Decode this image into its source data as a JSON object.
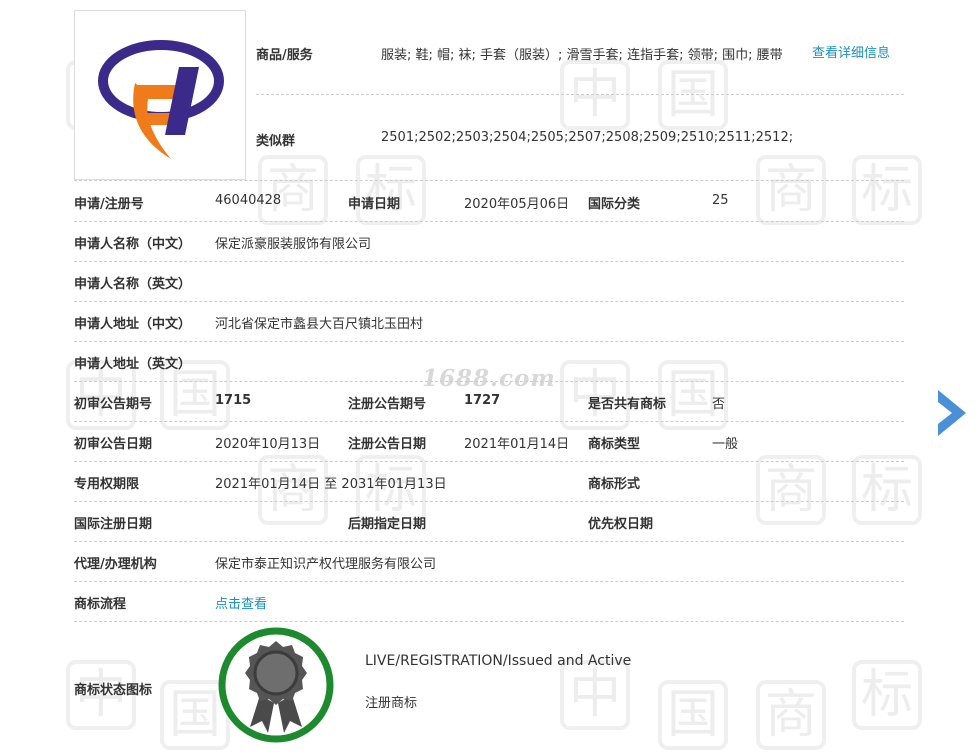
{
  "goods": {
    "label": "商品/服务",
    "value": "服装; 鞋; 帽; 袜; 手套（服装）; 滑雪手套; 连指手套; 领带; 围巾; 腰带",
    "more_link": "查看详细信息"
  },
  "similar_group": {
    "label": "类似群",
    "value": "2501;2502;2503;2504;2505;2507;2508;2509;2510;2511;2512;"
  },
  "rows": {
    "reg_no": {
      "label": "申请/注册号",
      "value": "46040428"
    },
    "app_date": {
      "label": "申请日期",
      "value": "2020年05月06日"
    },
    "intl_class": {
      "label": "国际分类",
      "value": "25"
    },
    "applicant_cn": {
      "label": "申请人名称（中文）",
      "value": "保定派豪服装服饰有限公司"
    },
    "applicant_en": {
      "label": "申请人名称（英文）",
      "value": ""
    },
    "address_cn": {
      "label": "申请人地址（中文）",
      "value": "河北省保定市蠡县大百尺镇北玉田村"
    },
    "address_en": {
      "label": "申请人地址（英文）",
      "value": ""
    },
    "prelim_issue": {
      "label": "初审公告期号",
      "value": "1715"
    },
    "reg_issue": {
      "label": "注册公告期号",
      "value": "1727"
    },
    "shared": {
      "label": "是否共有商标",
      "value": "否"
    },
    "prelim_date": {
      "label": "初审公告日期",
      "value": "2020年10月13日"
    },
    "reg_date": {
      "label": "注册公告日期",
      "value": "2021年01月14日"
    },
    "tm_type": {
      "label": "商标类型",
      "value": "一般"
    },
    "exclusive_period": {
      "label": "专用权期限",
      "value": "2021年01月14日 至 2031年01月13日"
    },
    "tm_form": {
      "label": "商标形式",
      "value": ""
    },
    "intl_reg_date": {
      "label": "国际注册日期",
      "value": ""
    },
    "later_date": {
      "label": "后期指定日期",
      "value": ""
    },
    "priority_date": {
      "label": "优先权日期",
      "value": ""
    },
    "agent": {
      "label": "代理/办理机构",
      "value": "保定市泰正知识产权代理服务有限公司"
    },
    "process": {
      "label": "商标流程",
      "value": "点击查看"
    }
  },
  "status": {
    "label": "商标状态图标",
    "en": "LIVE/REGISTRATION/Issued and Active",
    "cn": "注册商标"
  },
  "watermark": {
    "site": "1688.com",
    "chars": [
      "中",
      "国",
      "商",
      "标"
    ]
  },
  "colors": {
    "link": "#1a8fc6",
    "arrow": "#4a90d9",
    "status_ring": "#1e8a2e",
    "logo_purple": "#3b2a8a",
    "logo_orange": "#ef7b1a"
  },
  "icons": {
    "logo": "trademark-logo-image",
    "status": "award-badge-icon",
    "next": "chevron-right-icon"
  }
}
